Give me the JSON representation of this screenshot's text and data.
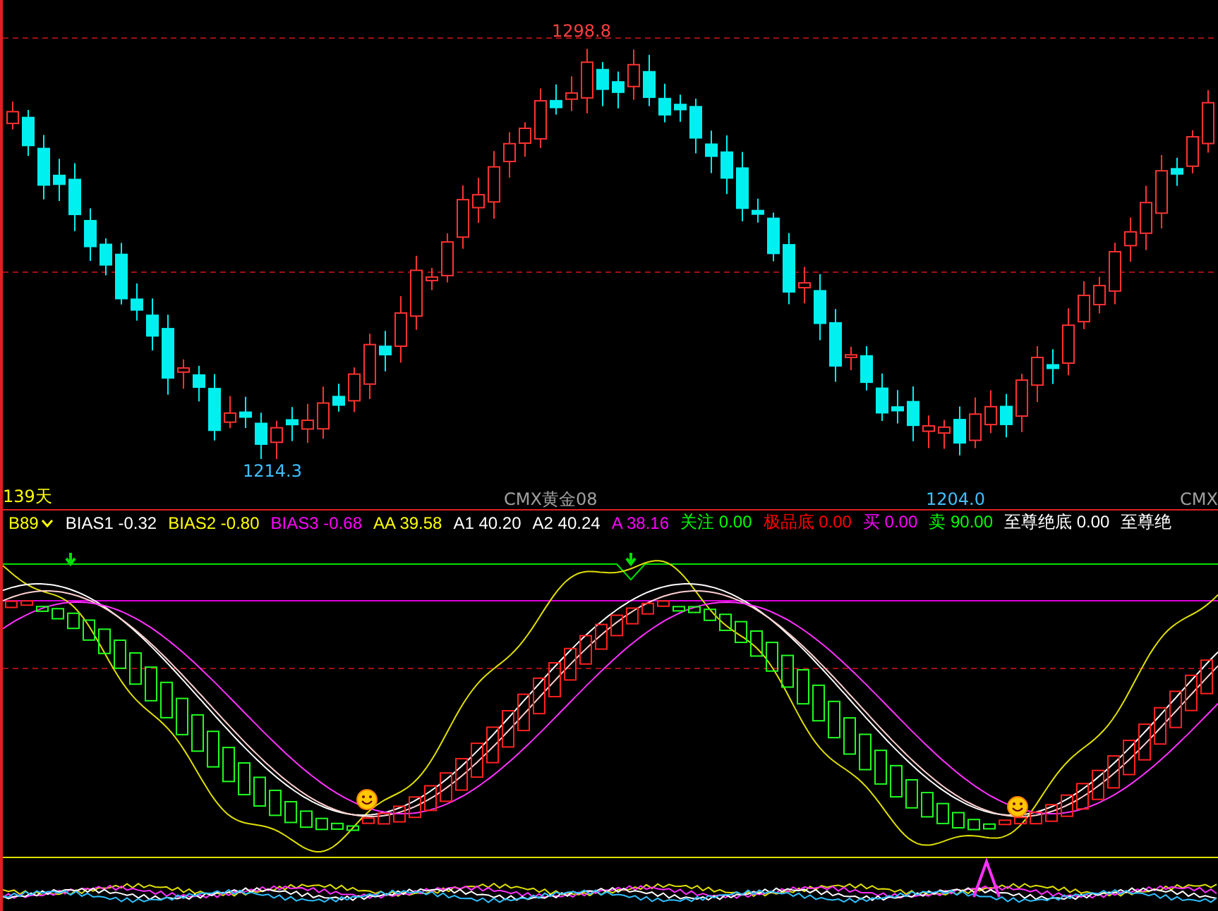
{
  "price_chart": {
    "high_label": "1298.8",
    "low_labels": [
      "1214.3",
      "1204.0"
    ],
    "period_label": "139天",
    "contract_labels": [
      "CMX黄金08",
      "CMX"
    ]
  },
  "legend": {
    "name": "B89",
    "items": [
      {
        "label": "BIAS1",
        "value": "-0.32",
        "color": "#ffffff"
      },
      {
        "label": "BIAS2",
        "value": "-0.80",
        "color": "#ffff00"
      },
      {
        "label": "BIAS3",
        "value": "-0.68",
        "color": "#ff00ff"
      },
      {
        "label": "AA",
        "value": "39.58",
        "color": "#ffff00"
      },
      {
        "label": "A1",
        "value": "40.20",
        "color": "#ffffff"
      },
      {
        "label": "A2",
        "value": "40.24",
        "color": "#ffffff"
      },
      {
        "label": "A",
        "value": "38.16",
        "color": "#ff00ff"
      },
      {
        "label": "关注",
        "value": "0.00",
        "color": "#00ff00"
      },
      {
        "label": "极品底",
        "value": "0.00",
        "color": "#ff0000"
      },
      {
        "label": "买",
        "value": "0.00",
        "color": "#ff00ff"
      },
      {
        "label": "卖",
        "value": "90.00",
        "color": "#00ff00"
      },
      {
        "label": "至尊绝底",
        "value": "0.00",
        "color": "#ffffff"
      },
      {
        "label": "至尊绝",
        "value": "",
        "color": "#ffffff"
      }
    ]
  }
}
